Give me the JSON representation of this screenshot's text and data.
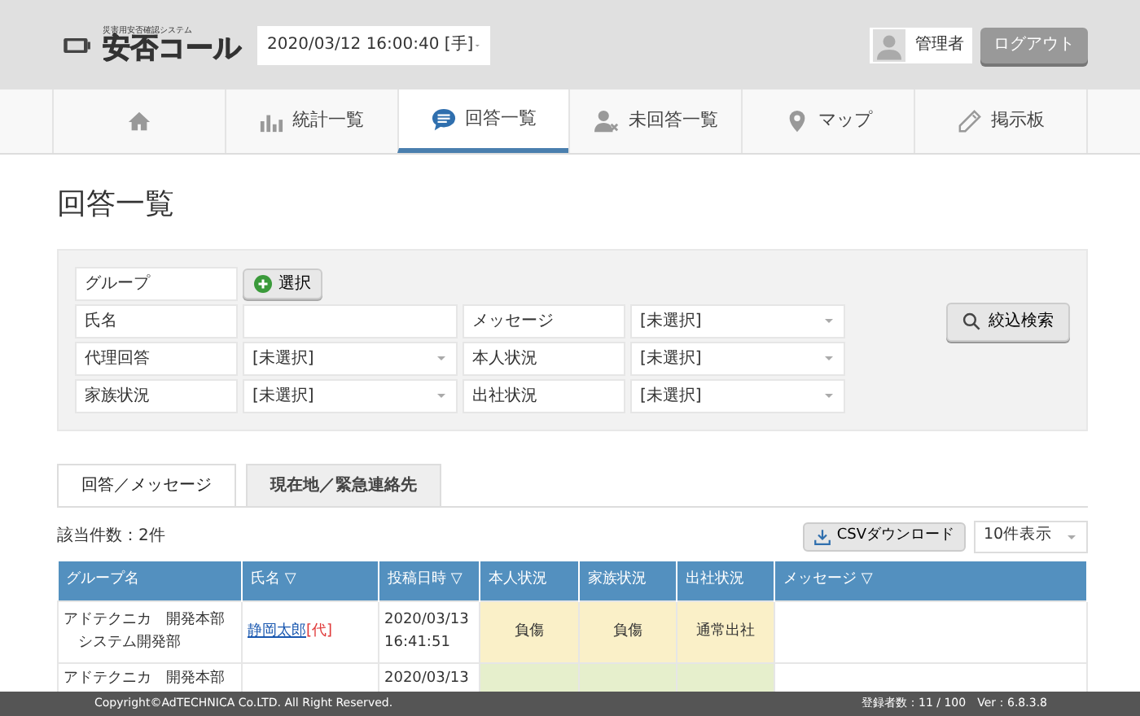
{
  "header": {
    "logo_tagline": "災害用安否確認システム",
    "logo_text": "安否コール",
    "datetime_select": "2020/03/12 16:00:40 [手]",
    "user": "管理者",
    "logout": "ログアウト"
  },
  "nav": [
    {
      "selected": false
    },
    {
      "label": "統計一覧",
      "selected": false
    },
    {
      "label": "回答一覧",
      "selected": true
    },
    {
      "label": "未回答一覧",
      "selected": false
    },
    {
      "label": "マップ",
      "selected": false
    },
    {
      "label": "掲示板",
      "selected": false
    }
  ],
  "page_title": "回答一覧",
  "filter": {
    "group_label": "グループ",
    "group_button": "選択",
    "search_button": "絞込検索",
    "rows": [
      {
        "label": "氏名",
        "kind": "text",
        "value": "",
        "label2": "メッセージ",
        "value2": "[未選択]"
      },
      {
        "label": "代理回答",
        "kind": "select",
        "value": "[未選択]",
        "label2": "本人状況",
        "value2": "[未選択]"
      },
      {
        "label": "家族状況",
        "kind": "select",
        "value": "[未選択]",
        "label2": "出社状況",
        "value2": "[未選択]"
      }
    ]
  },
  "tabs": [
    {
      "label": "回答／メッセージ",
      "selected": true
    },
    {
      "label": "現在地／緊急連絡先",
      "selected": false
    }
  ],
  "count": "該当件数：2件",
  "csv_button": "CSVダウンロード",
  "page_size": "10件表示",
  "table": {
    "columns": [
      "グループ名",
      "氏名 ▽",
      "投稿日時 ▽",
      "本人状況",
      "家族状況",
      "出社状況",
      "メッセージ ▽"
    ],
    "rows": [
      {
        "group": [
          "アドテクニカ　開発本部",
          "　システム開発部"
        ],
        "name": "静岡太郎",
        "proxy_mark": "[代]",
        "posted": [
          "2020/03/13",
          "16:41:51"
        ],
        "statuses": [
          {
            "text": "負傷",
            "color": "#faf0c8"
          },
          {
            "text": "負傷",
            "color": "#faf0c8"
          },
          {
            "text": "通常出社",
            "color": "#faf0c8"
          }
        ],
        "message": ""
      },
      {
        "group": [
          "アドテクニカ　開発本部"
        ],
        "name": "",
        "proxy_mark": "",
        "posted": [
          "2020/03/13"
        ],
        "statuses": [
          {
            "color": "#e6efcc"
          },
          {
            "color": "#e6efcc"
          },
          {
            "color": "#e6efcc"
          }
        ],
        "message": ""
      }
    ]
  },
  "footer": {
    "copyright": "Copyright©AdTECHNICA Co.LTD. All Right Reserved.",
    "stats": "登録者数：11 / 100　Ver：6.8.3.8"
  }
}
